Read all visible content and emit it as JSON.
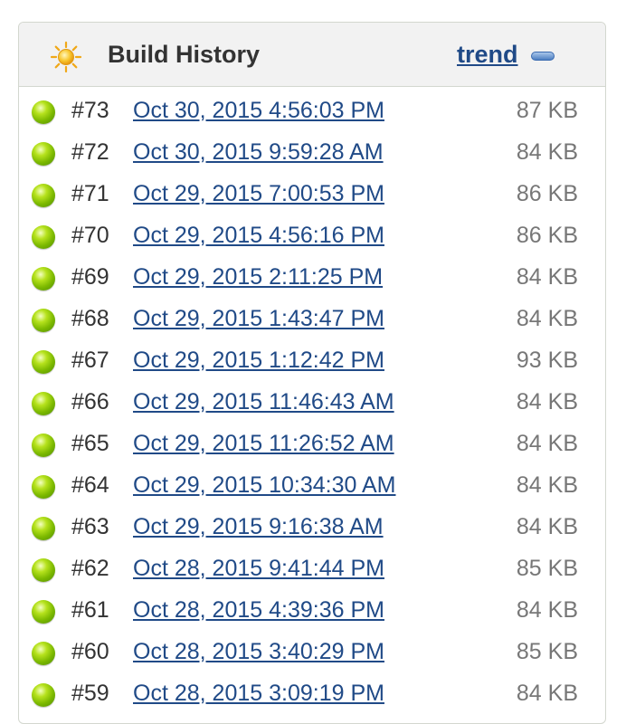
{
  "header": {
    "title": "Build History",
    "trend_label": "trend",
    "weather_icon": "sun-icon",
    "collapse_icon": "minus-icon"
  },
  "colors": {
    "link": "#204a87",
    "status_success": "#7bb800",
    "size_text": "#777777"
  },
  "builds": [
    {
      "number": "#73",
      "date": "Oct 30, 2015 4:56:03 PM",
      "size": "87 KB",
      "status": "success"
    },
    {
      "number": "#72",
      "date": "Oct 30, 2015 9:59:28 AM",
      "size": "84 KB",
      "status": "success"
    },
    {
      "number": "#71",
      "date": "Oct 29, 2015 7:00:53 PM",
      "size": "86 KB",
      "status": "success"
    },
    {
      "number": "#70",
      "date": "Oct 29, 2015 4:56:16 PM",
      "size": "86 KB",
      "status": "success"
    },
    {
      "number": "#69",
      "date": "Oct 29, 2015 2:11:25 PM",
      "size": "84 KB",
      "status": "success"
    },
    {
      "number": "#68",
      "date": "Oct 29, 2015 1:43:47 PM",
      "size": "84 KB",
      "status": "success"
    },
    {
      "number": "#67",
      "date": "Oct 29, 2015 1:12:42 PM",
      "size": "93 KB",
      "status": "success"
    },
    {
      "number": "#66",
      "date": "Oct 29, 2015 11:46:43 AM",
      "size": "84 KB",
      "status": "success"
    },
    {
      "number": "#65",
      "date": "Oct 29, 2015 11:26:52 AM",
      "size": "84 KB",
      "status": "success"
    },
    {
      "number": "#64",
      "date": "Oct 29, 2015 10:34:30 AM",
      "size": "84 KB",
      "status": "success"
    },
    {
      "number": "#63",
      "date": "Oct 29, 2015 9:16:38 AM",
      "size": "84 KB",
      "status": "success"
    },
    {
      "number": "#62",
      "date": "Oct 28, 2015 9:41:44 PM",
      "size": "85 KB",
      "status": "success"
    },
    {
      "number": "#61",
      "date": "Oct 28, 2015 4:39:36 PM",
      "size": "84 KB",
      "status": "success"
    },
    {
      "number": "#60",
      "date": "Oct 28, 2015 3:40:29 PM",
      "size": "85 KB",
      "status": "success"
    },
    {
      "number": "#59",
      "date": "Oct 28, 2015 3:09:19 PM",
      "size": "84 KB",
      "status": "success"
    }
  ]
}
